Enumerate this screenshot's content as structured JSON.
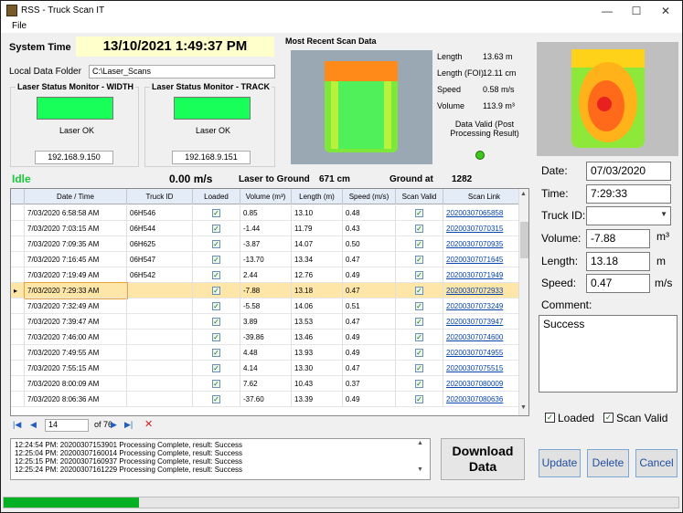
{
  "window": {
    "title": "RSS - Truck Scan IT",
    "minimize": "—",
    "maximize": "☐",
    "close": "✕"
  },
  "menu": {
    "file": "File"
  },
  "system_time": {
    "label": "System Time",
    "value": "13/10/2021 1:49:37 PM"
  },
  "local_folder": {
    "label": "Local Data Folder",
    "value": "C:\\Laser_Scans"
  },
  "laser_width": {
    "title": "Laser Status Monitor - WIDTH",
    "status": "Laser OK",
    "ip": "192.168.9.150"
  },
  "laser_track": {
    "title": "Laser Status Monitor - TRACK",
    "status": "Laser OK",
    "ip": "192.168.9.151"
  },
  "recent_scan": {
    "title": "Most Recent Scan Data",
    "length_label": "Length",
    "length_value": "13.63 m",
    "length_foi_label": "Length (FOI)",
    "length_foi_value": "12.11 cm",
    "speed_label": "Speed",
    "speed_value": "0.58 m/s",
    "volume_label": "Volume",
    "volume_value": "113.9 m³",
    "valid_text": "Data Valid (Post Processing Result)"
  },
  "status_line": {
    "state": "Idle",
    "speed": "0.00 m/s",
    "laser_ground_label": "Laser to Ground",
    "laser_ground_value": "671 cm",
    "ground_at_label": "Ground at",
    "ground_at_value": "1282"
  },
  "grid": {
    "columns": [
      "Date / Time",
      "Truck ID",
      "Loaded",
      "Volume (m³)",
      "Length (m)",
      "Speed (m/s)",
      "Scan Valid",
      "Scan Link"
    ],
    "rows": [
      [
        "7/03/2020 6:58:58 AM",
        "06H546",
        true,
        "0.85",
        "13.10",
        "0.48",
        true,
        "20200307065858"
      ],
      [
        "7/03/2020 7:03:15 AM",
        "06H544",
        true,
        "-1.44",
        "11.79",
        "0.43",
        true,
        "20200307070315"
      ],
      [
        "7/03/2020 7:09:35 AM",
        "06H625",
        true,
        "-3.87",
        "14.07",
        "0.50",
        true,
        "20200307070935"
      ],
      [
        "7/03/2020 7:16:45 AM",
        "06H547",
        true,
        "-13.70",
        "13.34",
        "0.47",
        true,
        "20200307071645"
      ],
      [
        "7/03/2020 7:19:49 AM",
        "06H542",
        true,
        "2.44",
        "12.76",
        "0.49",
        true,
        "20200307071949"
      ],
      [
        "7/03/2020 7:29:33 AM",
        "",
        true,
        "-7.88",
        "13.18",
        "0.47",
        true,
        "20200307072933"
      ],
      [
        "7/03/2020 7:32:49 AM",
        "",
        true,
        "-5.58",
        "14.06",
        "0.51",
        true,
        "20200307073249"
      ],
      [
        "7/03/2020 7:39:47 AM",
        "",
        true,
        "3.89",
        "13.53",
        "0.47",
        true,
        "20200307073947"
      ],
      [
        "7/03/2020 7:46:00 AM",
        "",
        true,
        "-39.86",
        "13.46",
        "0.49",
        true,
        "20200307074600"
      ],
      [
        "7/03/2020 7:49:55 AM",
        "",
        true,
        "4.48",
        "13.93",
        "0.49",
        true,
        "20200307074955"
      ],
      [
        "7/03/2020 7:55:15 AM",
        "",
        true,
        "4.14",
        "13.30",
        "0.47",
        true,
        "20200307075515"
      ],
      [
        "7/03/2020 8:00:09 AM",
        "",
        true,
        "7.62",
        "10.43",
        "0.37",
        true,
        "20200307080009"
      ],
      [
        "7/03/2020 8:06:36 AM",
        "",
        true,
        "-37.60",
        "13.39",
        "0.49",
        true,
        "20200307080636"
      ]
    ],
    "selected_index": 5
  },
  "nav": {
    "position": "14",
    "of_total": "of 76"
  },
  "log_lines": [
    "12:24:54 PM: 20200307153901 Processing Complete, result: Success",
    "12:25:04 PM: 20200307160014 Processing Complete, result: Success",
    "12:25:15 PM: 20200307160937 Processing Complete, result: Success",
    "12:25:24 PM: 20200307161229 Processing Complete, result: Success"
  ],
  "download_button": {
    "line1": "Download",
    "line2": "Data"
  },
  "progress_percent": 20,
  "detail": {
    "date_label": "Date:",
    "date_value": "07/03/2020",
    "time_label": "Time:",
    "time_value": "7:29:33",
    "truck_label": "Truck ID:",
    "truck_value": "",
    "volume_label": "Volume:",
    "volume_value": "-7.88",
    "volume_unit": "m³",
    "length_label": "Length:",
    "length_value": "13.18",
    "length_unit": "m",
    "speed_label": "Speed:",
    "speed_value": "0.47",
    "speed_unit": "m/s",
    "comment_label": "Comment:",
    "comment_value": "Success",
    "loaded_label": "Loaded",
    "scan_valid_label": "Scan Valid",
    "update": "Update",
    "delete": "Delete",
    "cancel": "Cancel"
  },
  "colors": {
    "led_green": "#19ff5a",
    "accent_blue": "#1f5fbf",
    "selected_row": "#fde6a8",
    "progress": "#06b025"
  }
}
